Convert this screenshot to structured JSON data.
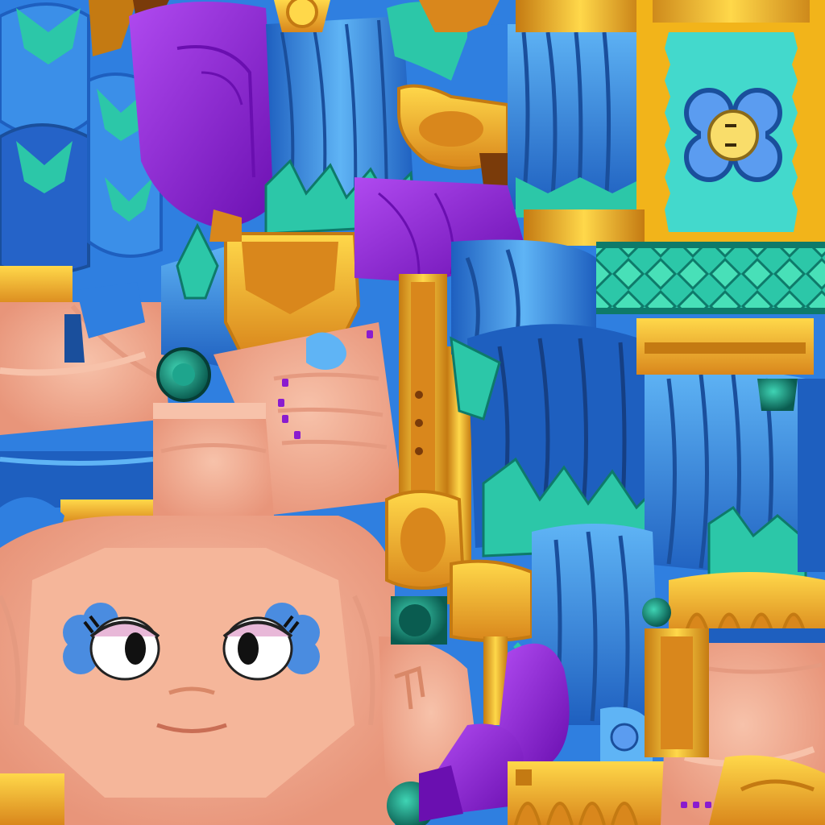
{
  "texture": {
    "palette": {
      "deep_blue": "#1e5fbf",
      "mid_blue": "#2f7fe0",
      "light_blue": "#5fb4f5",
      "teal": "#2cc7a8",
      "mint": "#48e0b8",
      "dark_teal": "#0e7a6a",
      "purple": "#8a1ccf",
      "violet": "#a83ee6",
      "gold": "#f2b41a",
      "dark_gold": "#c47a12",
      "yellow": "#ffd84a",
      "orange": "#d9871c",
      "skin": "#f2ae93",
      "skin_shadow": "#e59a80",
      "skin_light": "#f7c2aa",
      "aqua_panel": "#43d9cc",
      "flower_blue": "#5b9cf0",
      "flower_dark": "#1a4f9c",
      "flower_center": "#f9dd6a",
      "eye_white": "#ffffff",
      "eye_black": "#111111",
      "eyelid_pink": "#e8b8d8",
      "polish": "#8a1ccf"
    },
    "icons": [
      "flower-emblem-icon",
      "character-face-icon",
      "eye-icon",
      "gem-stud-icon",
      "leaf-icon"
    ]
  }
}
